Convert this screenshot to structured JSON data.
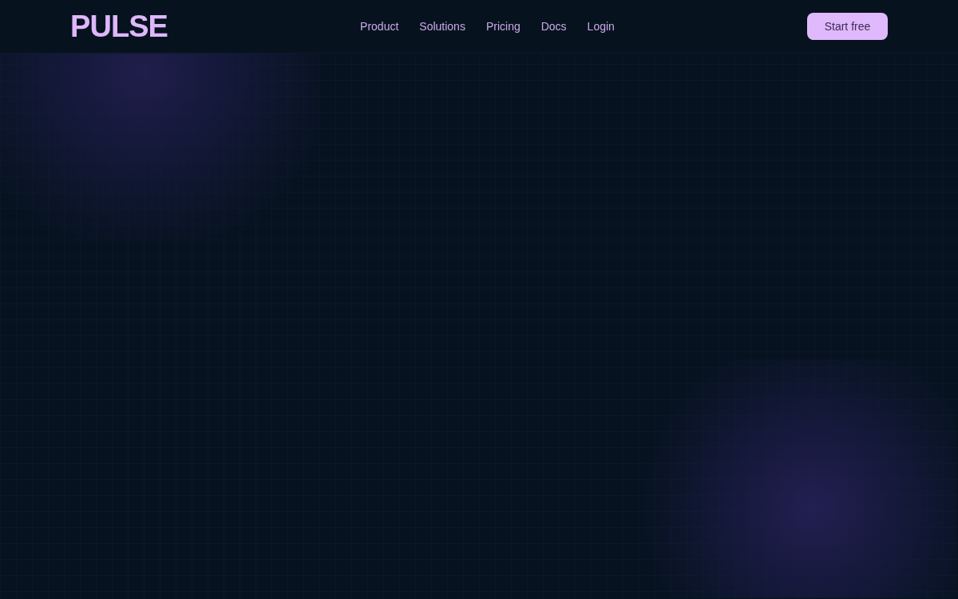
{
  "header": {
    "logo": "PULSE",
    "nav": [
      "Product",
      "Solutions",
      "Pricing",
      "Docs",
      "Login"
    ],
    "cta": {
      "label": "Start free"
    }
  }
}
